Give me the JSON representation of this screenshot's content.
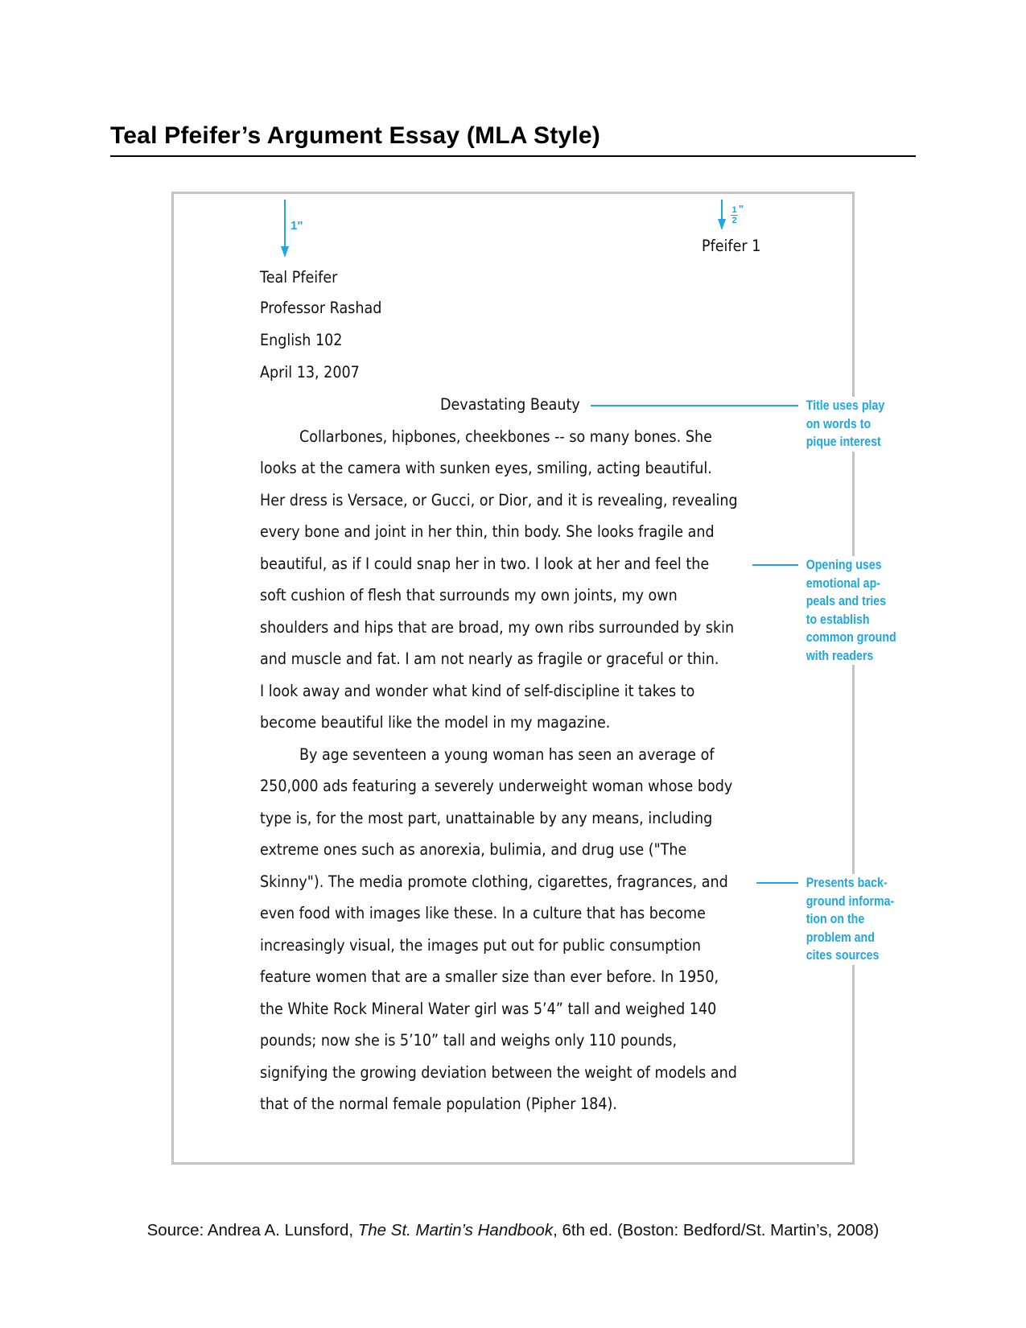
{
  "heading": "Teal Pfeifer’s Argument Essay (MLA Style)",
  "margins": {
    "top_label": "1\"",
    "header_label_num": "1",
    "header_label_den": "2",
    "header_label_unit": "\""
  },
  "essay": {
    "running_head": "Pfeifer 1",
    "heading_block": [
      "Teal Pfeifer",
      "Professor Rashad",
      "English 102",
      "April 13, 2007"
    ],
    "title": "Devastating Beauty",
    "lines": [
      "Collarbones, hipbones, cheekbones -- so many bones. She",
      "looks at the camera with sunken eyes, smiling, acting beautiful.",
      "Her dress is Versace, or Gucci, or Dior, and it is revealing, revealing",
      "every bone and joint in her thin, thin body. She looks fragile and",
      "beautiful, as if I could snap her in two. I look at her and feel the",
      "soft cushion of flesh that surrounds my own joints, my own",
      "shoulders and hips that are broad, my own ribs surrounded by skin",
      "and muscle and fat. I am not nearly as fragile or graceful or thin.",
      "I look away and wonder what kind of self-discipline it takes to",
      "become beautiful like the model in my magazine.",
      "By age seventeen a young woman has seen an average of",
      "250,000 ads featuring a severely underweight woman whose body",
      "type is, for the most part, unattainable by any means, including",
      "extreme ones such as anorexia, bulimia, and drug use (\"The",
      "Skinny\"). The media promote clothing, cigarettes, fragrances, and",
      "even food with images like these. In a culture that has become",
      "increasingly visual, the images put out for public consumption",
      "feature women that are a smaller size than ever before. In 1950,",
      "the White Rock Mineral Water girl was 5’4” tall and weighed 140",
      "pounds; now she is 5’10” tall and weighs only 110 pounds,",
      "signifying the growing deviation between the weight of models and",
      "that of the normal female population (Pipher 184)."
    ]
  },
  "annotations": [
    {
      "lines": [
        "Title uses play",
        "on words to",
        "pique interest"
      ]
    },
    {
      "lines": [
        "Opening uses",
        "emotional ap-",
        "peals and tries",
        "to establish",
        "common ground",
        "with readers"
      ]
    },
    {
      "lines": [
        "Presents back-",
        "ground informa-",
        "tion on the",
        "problem and",
        "cites sources"
      ]
    }
  ],
  "source": {
    "prefix": "Source: Andrea A. Lunsford, ",
    "book": "The St. Martin’s Handbook",
    "suffix": ", 6th ed. (Boston: Bedford/St. Martin’s, 2008)"
  },
  "colors": {
    "annotation": "#1ea7e1",
    "frame": "#c3c3c3"
  }
}
